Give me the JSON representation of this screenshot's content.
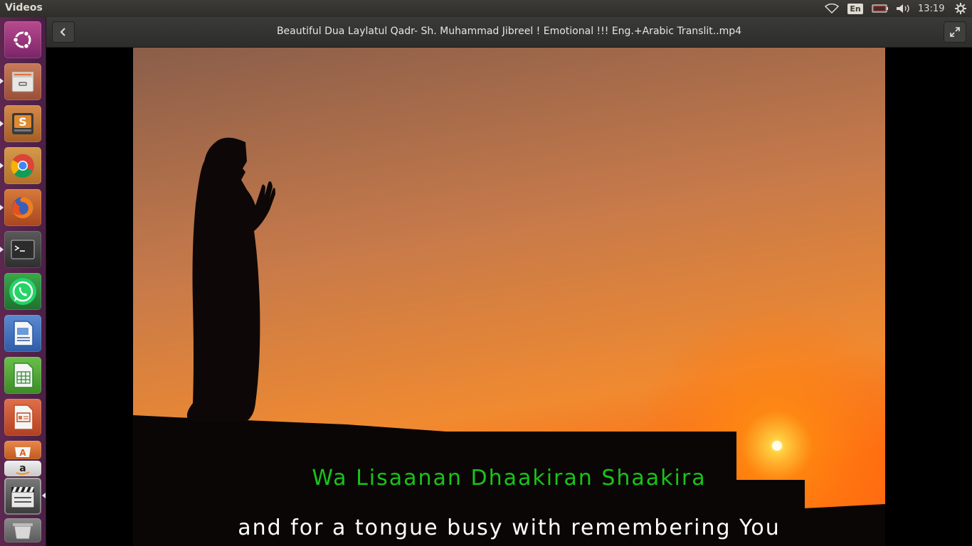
{
  "top_panel": {
    "app_title": "Videos",
    "language": "En",
    "clock": "13:19",
    "icons": [
      "wifi-icon",
      "keyboard-language-indicator",
      "battery-icon",
      "volume-icon",
      "settings-gear-icon"
    ]
  },
  "launcher": {
    "items": [
      {
        "name": "ubuntu-dash"
      },
      {
        "name": "files"
      },
      {
        "name": "sublime-text"
      },
      {
        "name": "chrome"
      },
      {
        "name": "firefox"
      },
      {
        "name": "terminal"
      },
      {
        "name": "whatsapp"
      },
      {
        "name": "libreoffice-writer"
      },
      {
        "name": "libreoffice-calc"
      },
      {
        "name": "libreoffice-impress"
      },
      {
        "name": "software-center"
      },
      {
        "name": "amazon"
      },
      {
        "name": "videos"
      },
      {
        "name": "trash"
      }
    ]
  },
  "header": {
    "title": "Beautiful Dua Laylatul Qadr- Sh. Muhammad Jibreel ! Emotional !!! Eng.+Arabic Translit..mp4"
  },
  "subtitles": {
    "line_1": "Wa Lisaanan Dhaakiran Shaakira",
    "line_2": "and for a tongue busy with remembering You"
  },
  "colors": {
    "launcher_bg": "#5e2750",
    "subtitle_transliteration": "#18c418",
    "subtitle_translation": "#ffffff",
    "sky_top": "#8a5e4a",
    "sky_bottom": "#ff7a10"
  }
}
